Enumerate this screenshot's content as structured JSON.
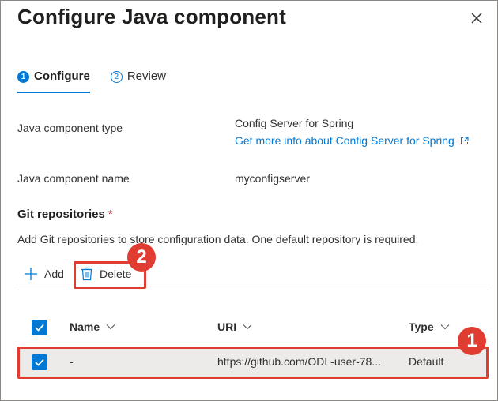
{
  "dialog": {
    "title": "Configure Java component",
    "close_icon": "close-icon"
  },
  "tabs": [
    {
      "number": "1",
      "label": "Configure",
      "active": true
    },
    {
      "number": "2",
      "label": "Review",
      "active": false
    }
  ],
  "fields": {
    "type_label": "Java component type",
    "type_value": "Config Server for Spring",
    "info_link": "Get more info about Config Server for Spring",
    "name_label": "Java component name",
    "name_value": "myconfigserver"
  },
  "git": {
    "title": "Git repositories",
    "required_mark": "*",
    "description": "Add Git repositories to store configuration data. One default repository is required."
  },
  "toolbar": {
    "add_label": "Add",
    "delete_label": "Delete"
  },
  "table": {
    "columns": [
      "Name",
      "URI",
      "Type"
    ],
    "rows": [
      {
        "name": "-",
        "uri": "https://github.com/ODL-user-78...",
        "type": "Default",
        "selected": true
      }
    ]
  },
  "callouts": [
    "1",
    "2"
  ],
  "colors": {
    "accent": "#0078d4",
    "callout": "#e03c31",
    "selected_row": "#edebe9"
  }
}
